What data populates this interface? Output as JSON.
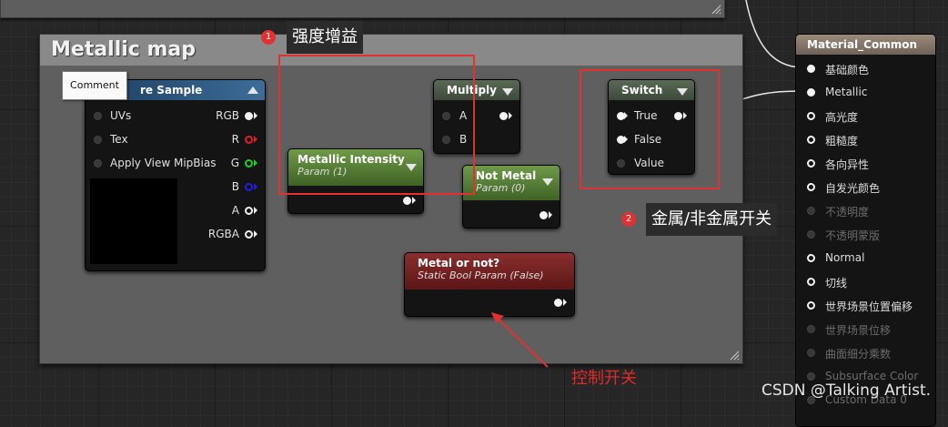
{
  "comment": {
    "title": "Metallic map"
  },
  "tooltip": {
    "text": "Comment"
  },
  "texture_node": {
    "title": "re Sample",
    "inputs": [
      "UVs",
      "Tex",
      "Apply View MipBias"
    ],
    "outputs": [
      {
        "label": "RGB",
        "color": "#f2f2f2"
      },
      {
        "label": "R",
        "color": "#e02020"
      },
      {
        "label": "G",
        "color": "#20d020"
      },
      {
        "label": "B",
        "color": "#2020e0"
      },
      {
        "label": "A",
        "color": "#d0d0d0"
      },
      {
        "label": "RGBA",
        "color": "#f2f2f2"
      }
    ]
  },
  "metallic_intensity": {
    "title": "Metallic Intensity",
    "subtitle": "Param (1)"
  },
  "multiply": {
    "title": "Multiply",
    "inputs": [
      "A",
      "B"
    ]
  },
  "not_metal": {
    "title": "Not Metal",
    "subtitle": "Param (0)"
  },
  "switch": {
    "title": "Switch",
    "inputs": [
      "True",
      "False",
      "Value"
    ]
  },
  "static_bool": {
    "title": "Metal or not?",
    "subtitle": "Static Bool Param (False)"
  },
  "annotations": {
    "badge1": "1",
    "label1": "强度增益",
    "badge2": "2",
    "label2": "金属/非金属开关",
    "label3": "控制开关"
  },
  "material": {
    "title": "Material_Common",
    "pins": [
      {
        "label": "基础颜色",
        "active": true,
        "filled": true
      },
      {
        "label": "Metallic",
        "active": true,
        "filled": true
      },
      {
        "label": "高光度",
        "active": true,
        "filled": false
      },
      {
        "label": "粗糙度",
        "active": true,
        "filled": false
      },
      {
        "label": "各向异性",
        "active": true,
        "filled": false
      },
      {
        "label": "自发光颜色",
        "active": true,
        "filled": false
      },
      {
        "label": "不透明度",
        "active": false,
        "filled": false
      },
      {
        "label": "不透明蒙版",
        "active": false,
        "filled": false
      },
      {
        "label": "Normal",
        "active": true,
        "filled": false
      },
      {
        "label": "切线",
        "active": true,
        "filled": false
      },
      {
        "label": "世界场景位置偏移",
        "active": true,
        "filled": false
      },
      {
        "label": "世界场景位移",
        "active": false,
        "filled": false
      },
      {
        "label": "曲面细分乘数",
        "active": false,
        "filled": false
      },
      {
        "label": "Subsurface Color",
        "active": false,
        "filled": false
      },
      {
        "label": "Custom Data 0",
        "active": false,
        "filled": false
      }
    ]
  },
  "watermark": "CSDN @Talking Artist.",
  "colors": {
    "annotation_red": "#e03232",
    "param_green": "#4f7a2c",
    "switch_head": "#4a5a48",
    "static_bool_head": "#7a2222"
  }
}
